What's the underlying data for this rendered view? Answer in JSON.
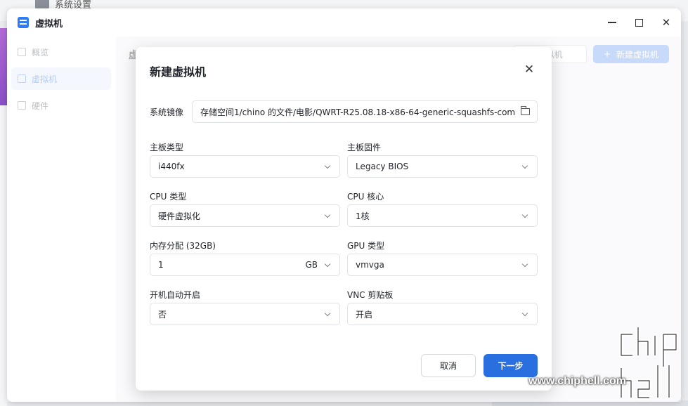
{
  "window": {
    "title": "虚拟机"
  },
  "background_window": {
    "title": "系统设置"
  },
  "sidebar": {
    "items": [
      {
        "label": "概览",
        "icon": "grid-icon"
      },
      {
        "label": "虚拟机",
        "icon": "cube-icon",
        "active": true
      },
      {
        "label": "硬件",
        "icon": "drive-icon"
      }
    ]
  },
  "main": {
    "heading_fragment": "虚",
    "outline_button_label": "虚拟机",
    "new_vm_button_label": "新建虚拟机"
  },
  "dialog": {
    "title": "新建虚拟机",
    "system_image": {
      "label": "系统镜像",
      "value": "存储空间1/chino 的文件/电影/QWRT-R25.08.18-x86-64-generic-squashfs-com"
    },
    "motherboard_type": {
      "label": "主板类型",
      "value": "i440fx"
    },
    "motherboard_firmware": {
      "label": "主板固件",
      "value": "Legacy BIOS"
    },
    "cpu_type": {
      "label": "CPU 类型",
      "value": "硬件虚拟化"
    },
    "cpu_cores": {
      "label": "CPU 核心",
      "value": "1核"
    },
    "memory": {
      "label": "内存分配 (32GB)",
      "value": "1",
      "unit": "GB"
    },
    "gpu_type": {
      "label": "GPU 类型",
      "value": "vmvga"
    },
    "autostart": {
      "label": "开机自动开启",
      "value": "否"
    },
    "vnc_clipboard": {
      "label": "VNC 剪贴板",
      "value": "开启"
    },
    "cancel_label": "取消",
    "next_label": "下一步"
  },
  "watermark": {
    "text": "www.chiphell.com",
    "logo_text": "chip hell"
  },
  "colors": {
    "primary": "#2a6fe0",
    "primary_disabled": "#a9c6f6",
    "sidebar_active_bg": "#eef3fc"
  }
}
